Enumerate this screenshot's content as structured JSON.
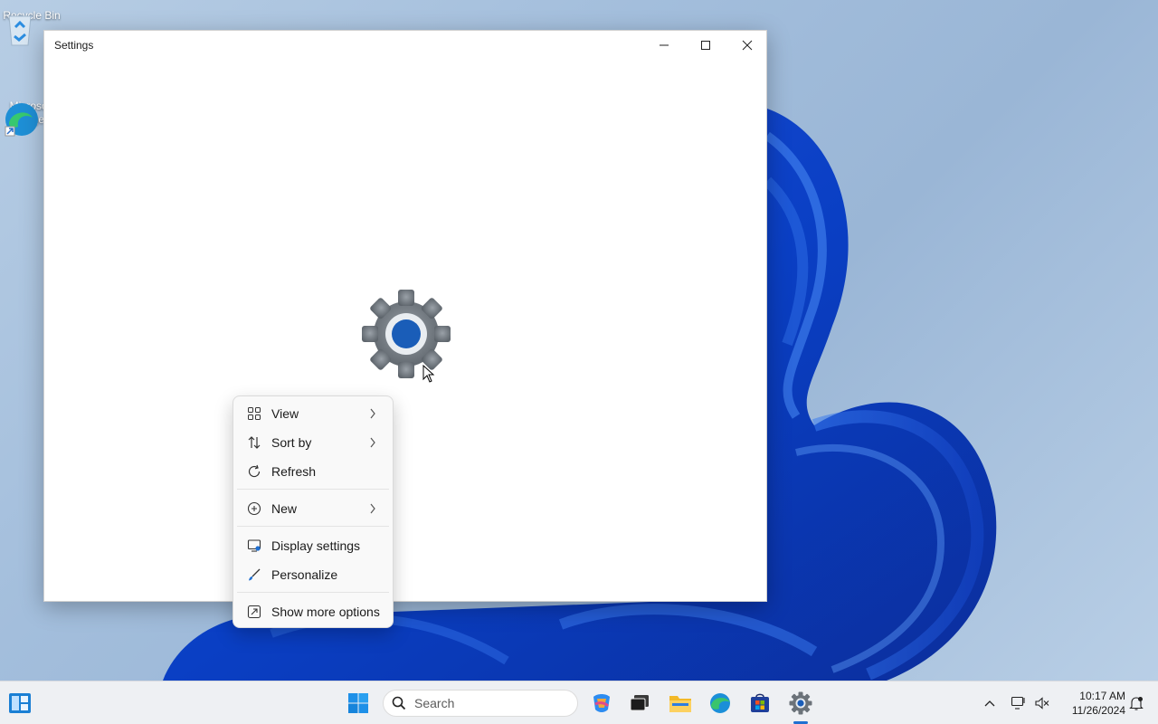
{
  "desktop": {
    "icons": [
      {
        "label": "Recycle Bin"
      },
      {
        "label": "Microsoft Edge"
      }
    ]
  },
  "window": {
    "title": "Settings"
  },
  "context_menu": {
    "items": [
      {
        "label": "View",
        "icon": "grid-icon",
        "submenu": true
      },
      {
        "label": "Sort by",
        "icon": "sort-icon",
        "submenu": true
      },
      {
        "label": "Refresh",
        "icon": "refresh-icon",
        "submenu": false
      },
      {
        "label": "New",
        "icon": "plus-circle-icon",
        "submenu": true
      },
      {
        "label": "Display settings",
        "icon": "display-settings-icon",
        "submenu": false
      },
      {
        "label": "Personalize",
        "icon": "brush-icon",
        "submenu": false
      },
      {
        "label": "Show more options",
        "icon": "expand-icon",
        "submenu": false
      }
    ]
  },
  "taskbar": {
    "search_placeholder": "Search",
    "time": "10:17 AM",
    "date": "11/26/2024",
    "accent": "#1f6fd1"
  }
}
